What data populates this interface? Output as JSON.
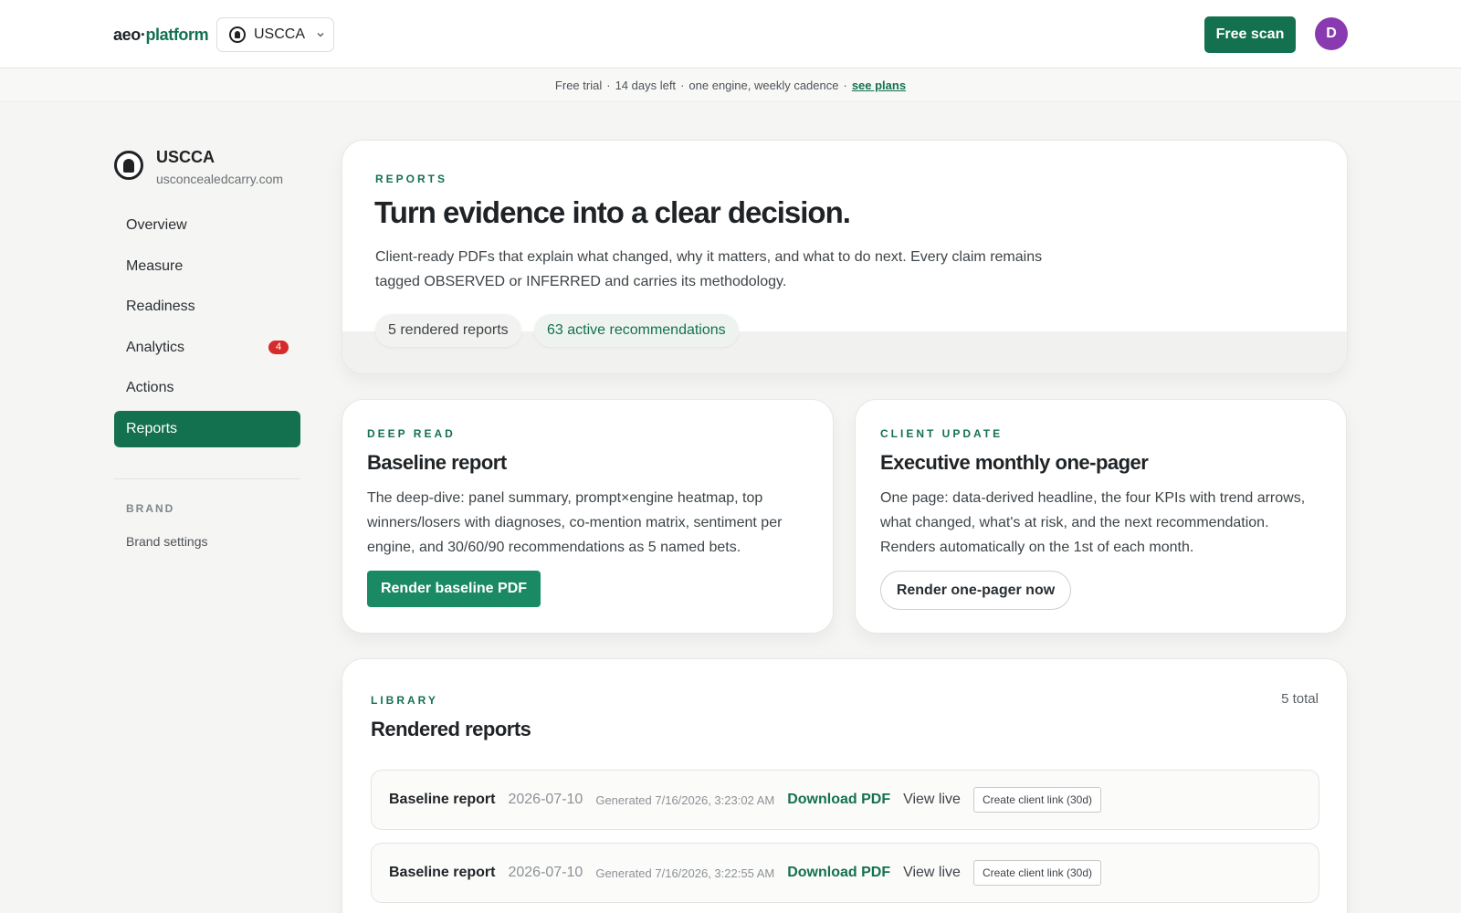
{
  "header": {
    "logo_main": "aeo",
    "logo_dot": "·",
    "logo_accent": "platform",
    "brand_select": "USCCA",
    "free_scan": "Free scan",
    "avatar_initial": "D",
    "accent_color": "#14714f",
    "avatar_color": "#8a3ab0"
  },
  "trial": {
    "part1": "Free trial",
    "part2": "14 days left",
    "part3": "one engine, weekly cadence",
    "sep": "·",
    "link": "see plans"
  },
  "sidebar": {
    "brand_name": "USCCA",
    "brand_url": "usconcealedcarry.com",
    "items": [
      {
        "label": "Overview"
      },
      {
        "label": "Measure"
      },
      {
        "label": "Readiness"
      },
      {
        "label": "Analytics",
        "badge": "4"
      },
      {
        "label": "Actions"
      },
      {
        "label": "Reports",
        "active": true
      }
    ],
    "section_label": "BRAND",
    "brand_settings": "Brand settings"
  },
  "hero": {
    "eyebrow": "REPORTS",
    "title": "Turn evidence into a clear decision.",
    "description": "Client-ready PDFs that explain what changed, why it matters, and what to do next. Every claim remains tagged OBSERVED or INFERRED and carries its methodology.",
    "pill_reports": "5 rendered reports",
    "pill_recs": "63 active recommendations"
  },
  "deep_read": {
    "eyebrow": "DEEP READ",
    "title": "Baseline report",
    "description": "The deep-dive: panel summary, prompt×engine heatmap, top winners/losers with diagnoses, co-mention matrix, sentiment per engine, and 30/60/90 recommendations as 5 named bets.",
    "button": "Render baseline PDF"
  },
  "client_update": {
    "eyebrow": "CLIENT UPDATE",
    "title": "Executive monthly one-pager",
    "description": "One page: data-derived headline, the four KPIs with trend arrows, what changed, what's at risk, and the next recommendation. Renders automatically on the 1st of each month.",
    "button": "Render one-pager now"
  },
  "library": {
    "eyebrow": "LIBRARY",
    "title": "Rendered reports",
    "total": "5 total",
    "rows": [
      {
        "title": "Baseline report",
        "date": "2026-07-10",
        "generated": "Generated 7/16/2026, 3:23:02 AM",
        "download": "Download PDF",
        "view": "View live",
        "link": "Create client link (30d)"
      },
      {
        "title": "Baseline report",
        "date": "2026-07-10",
        "generated": "Generated 7/16/2026, 3:22:55 AM",
        "download": "Download PDF",
        "view": "View live",
        "link": "Create client link (30d)"
      }
    ]
  }
}
